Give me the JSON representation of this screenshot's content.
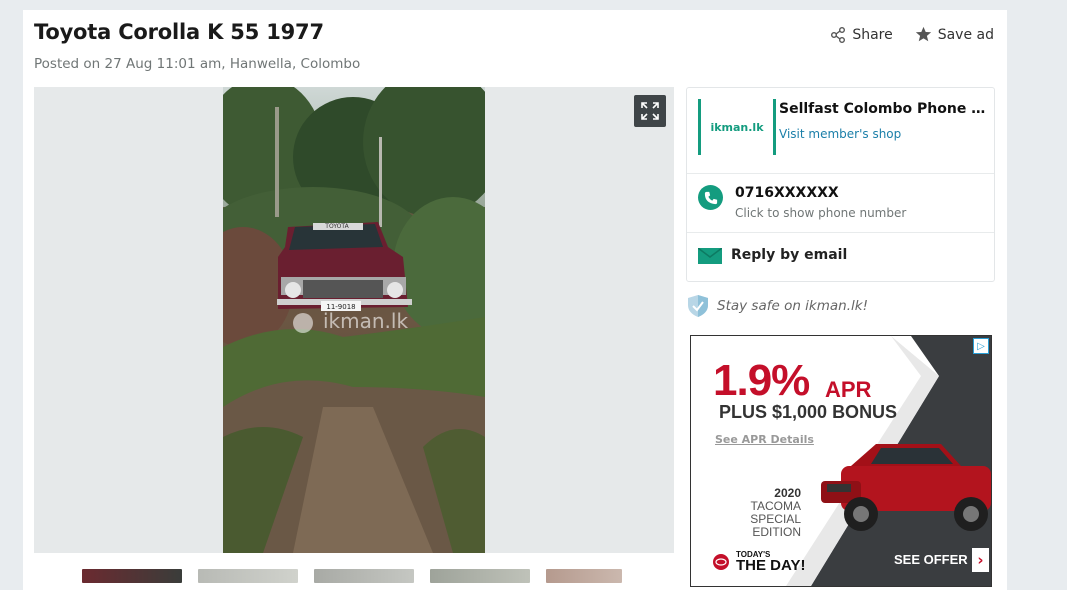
{
  "listing": {
    "title": "Toyota Corolla K 55 1977",
    "posted": "Posted on 27 Aug 11:01 am, Hanwella, Colombo"
  },
  "actions": {
    "share_label": "Share",
    "save_label": "Save ad"
  },
  "gallery": {
    "watermark": "ikman.lk",
    "plate": "11-9018",
    "car_badge": "TOYOTA",
    "thumbnail_count": 5
  },
  "seller": {
    "logo_text": "ikman.lk",
    "shop_name": "Sellfast Colombo Phone Shop",
    "shop_link": "Visit member's shop",
    "phone": "0716XXXXXX",
    "phone_hint": "Click to show phone number",
    "email_label": "Reply by email"
  },
  "safety": {
    "label": "Stay safe on ikman.lk!"
  },
  "ad": {
    "rate": "1.9%",
    "apr": "APR",
    "bonus": "PLUS $1,000 BONUS",
    "details": "See APR Details",
    "model_year": "2020",
    "model_name": "TACOMA",
    "model_edition": "SPECIAL EDITION",
    "brand_top": "TODAY'S",
    "brand_bottom": "THE DAY!",
    "offer": "SEE OFFER",
    "offer_arrow": "›"
  },
  "colors": {
    "brand_green": "#149c7f",
    "link_blue": "#1b7fa9",
    "ad_red": "#c40f2a"
  },
  "icons": {
    "share": "share-icon",
    "save": "star-icon",
    "expand": "expand-icon",
    "phone": "phone-icon",
    "email": "envelope-icon",
    "safety": "shield-check-icon",
    "ad_choices": "ad-choices-icon"
  }
}
